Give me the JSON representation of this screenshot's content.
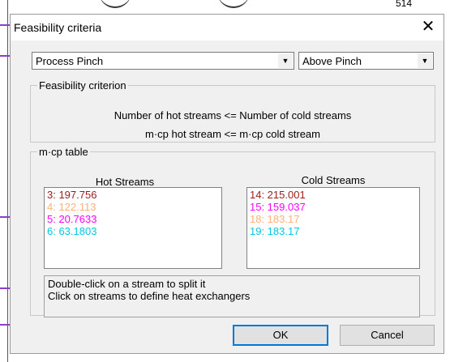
{
  "background": {
    "corner_text": "514"
  },
  "dialog": {
    "title": "Feasibility criteria",
    "close_symbol": "✕",
    "pinch_type_select": {
      "value": "Process Pinch"
    },
    "region_select": {
      "value": "Above Pinch"
    },
    "feasibility_criterion": {
      "legend": "Feasibility criterion",
      "line1": "Number of hot streams <= Number of cold streams",
      "line2": "m·cp hot stream <= m·cp cold stream"
    },
    "mcp_table": {
      "legend": "m·cp table",
      "hot_header": "Hot Streams",
      "cold_header": "Cold Streams",
      "hot_streams": [
        {
          "text": "3: 197.756",
          "color": "#9b1b1b"
        },
        {
          "text": "4: 122.113",
          "color": "#ffb07c"
        },
        {
          "text": "5: 20.7633",
          "color": "#ff00ff"
        },
        {
          "text": "6: 63.1803",
          "color": "#00c8e0"
        }
      ],
      "cold_streams": [
        {
          "text": "14: 215.001",
          "color": "#9b1b1b"
        },
        {
          "text": "15: 159.037",
          "color": "#ff00ff"
        },
        {
          "text": "18: 183.17",
          "color": "#ffb07c"
        },
        {
          "text": "19: 183.17",
          "color": "#00c8e0"
        }
      ],
      "info_line1": "Double-click on a stream to split it",
      "info_line2": "Click on streams to define heat exchangers"
    },
    "ok_label": "OK",
    "cancel_label": "Cancel"
  }
}
